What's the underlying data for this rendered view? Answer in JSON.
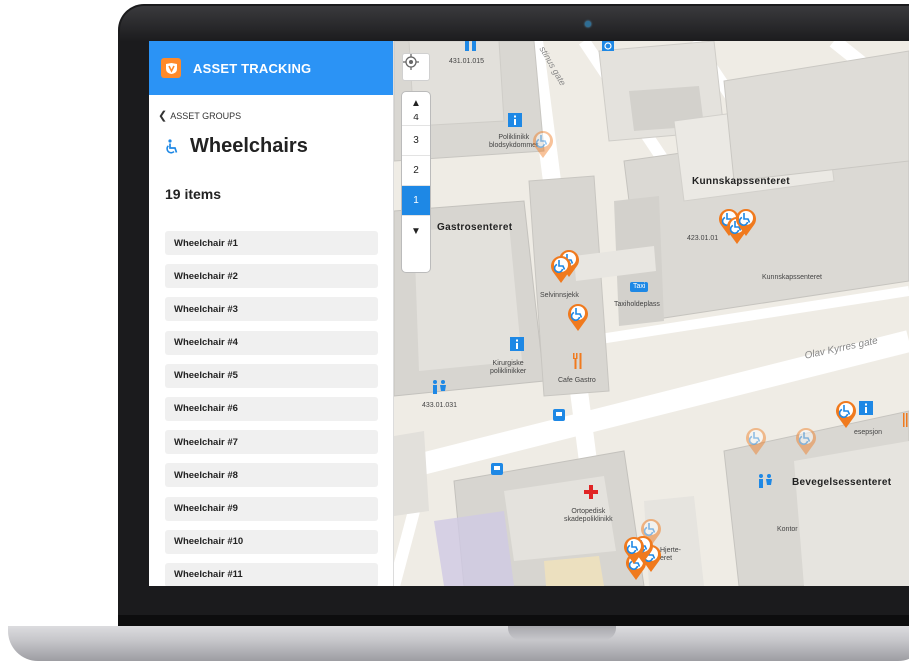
{
  "app": {
    "title": "ASSET TRACKING",
    "accent": "#2b93f5",
    "logo_color": "#ff8a2a"
  },
  "sidebar": {
    "back_label": "ASSET GROUPS",
    "group_icon": "wheelchair-icon",
    "group_title": "Wheelchairs",
    "count_label": "19 items",
    "items": [
      "Wheelchair #1",
      "Wheelchair #2",
      "Wheelchair #3",
      "Wheelchair #4",
      "Wheelchair #5",
      "Wheelchair #6",
      "Wheelchair #7",
      "Wheelchair #8",
      "Wheelchair #9",
      "Wheelchair #10",
      "Wheelchair #11"
    ]
  },
  "map": {
    "floor_up": "▲",
    "floor_down": "▼",
    "floors": [
      "4",
      "3",
      "2",
      "1"
    ],
    "active_floor": "1",
    "buildings": {
      "gastro": "Gastrosenteret",
      "kunnskap": "Kunnskapssenteret",
      "kunnskap_small": "Kunnskapssenteret",
      "bevegelse": "Bevegelsessenteret"
    },
    "rooms": {
      "r431": "431.01.015",
      "poliklinikk": "Poliklinikk\nblodsykdommer",
      "selvinnsjekk": "Selvinnsjekk",
      "taxi_badge": "Taxi",
      "taxiholdeplass": "Taxiholdeplass",
      "kirurgiske": "Kirurgiske\npoliklinikker",
      "cafe": "Cafe Gastro",
      "r433": "433.01.031",
      "r423": "423.01.01",
      "resepsjon": "esepsjon",
      "ortopedisk": "Ortopedisk\nskadepoliklinikk",
      "hjerte": "Hjerte-\neret",
      "kontor": "Kontor"
    },
    "streets": {
      "olav": "Olav Kyrres gate",
      "christies": "stinus gate"
    },
    "pin_color": "#f07a1e"
  }
}
